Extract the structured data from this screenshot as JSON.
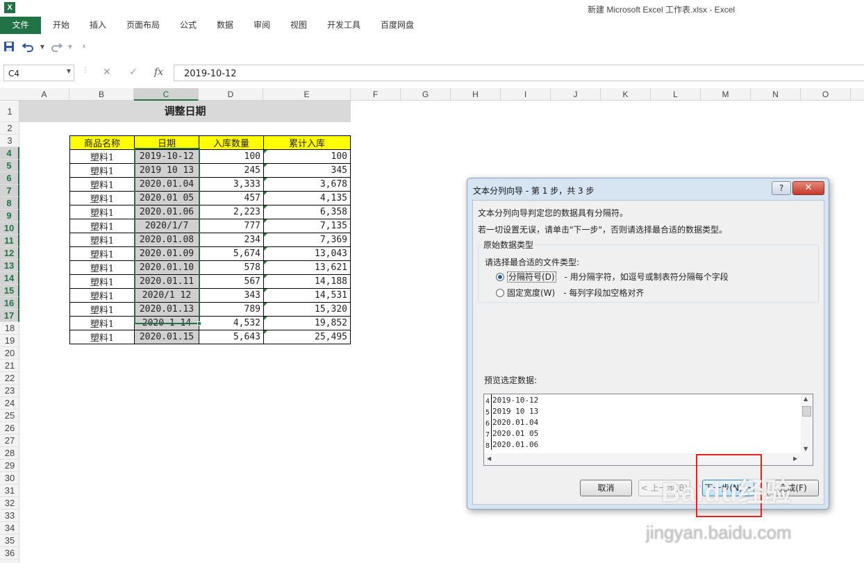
{
  "window": {
    "title": "新建 Microsoft Excel 工作表.xlsx - Excel",
    "app_icon": "X"
  },
  "ribbon": {
    "tabs": [
      "文件",
      "开始",
      "插入",
      "页面布局",
      "公式",
      "数据",
      "审阅",
      "视图",
      "开发工具",
      "百度网盘"
    ]
  },
  "qat": {
    "icons": [
      "save-icon",
      "undo-icon",
      "redo-icon",
      "customize-icon"
    ]
  },
  "formula_bar": {
    "name_box": "C4",
    "cancel": "✕",
    "enter": "✓",
    "fx": "fx",
    "value": "2019-10-12"
  },
  "grid": {
    "columns": [
      "A",
      "B",
      "C",
      "D",
      "E",
      "F",
      "G",
      "H",
      "I",
      "J",
      "K",
      "L",
      "M",
      "N",
      "O"
    ],
    "selected_column": "C",
    "rows": [
      "1",
      "2",
      "3",
      "4",
      "5",
      "6",
      "7",
      "8",
      "9",
      "10",
      "11",
      "12",
      "13",
      "14",
      "15",
      "16",
      "17",
      "18",
      "19",
      "20",
      "21",
      "22",
      "23",
      "24",
      "25",
      "26",
      "27",
      "28",
      "29",
      "30",
      "31",
      "32",
      "33",
      "34",
      "35",
      "36"
    ],
    "selected_rows": [
      "4",
      "5",
      "6",
      "7",
      "8",
      "9",
      "10",
      "11",
      "12",
      "13",
      "14",
      "15",
      "16",
      "17"
    ]
  },
  "sheet": {
    "title": "调整日期",
    "headers": [
      "商品名称",
      "日期",
      "入库数量",
      "累计入库"
    ],
    "rows": [
      [
        "塑料1",
        "2019-10-12",
        "100",
        "100"
      ],
      [
        "塑料1",
        "2019 10 13",
        "245",
        "345"
      ],
      [
        "塑料1",
        "2020.01.04",
        "3,333",
        "3,678"
      ],
      [
        "塑料1",
        "2020.01 05",
        "457",
        "4,135"
      ],
      [
        "塑料1",
        "2020.01.06",
        "2,223",
        "6,358"
      ],
      [
        "塑料1",
        "2020/1/7",
        "777",
        "7,135"
      ],
      [
        "塑料1",
        "2020.01.08",
        "234",
        "7,369"
      ],
      [
        "塑料1",
        "2020.01.09",
        "5,674",
        "13,043"
      ],
      [
        "塑料1",
        "2020.01.10",
        "578",
        "13,621"
      ],
      [
        "塑料1",
        "2020.01.11",
        "567",
        "14,188"
      ],
      [
        "塑料1",
        "2020/1 12",
        "343",
        "14,531"
      ],
      [
        "塑料1",
        "2020.01.13",
        "789",
        "15,320"
      ],
      [
        "塑料1",
        "2020-1 14",
        "4,532",
        "19,852"
      ],
      [
        "塑料1",
        "2020.01.15",
        "5,643",
        "25,495"
      ]
    ]
  },
  "dialog": {
    "title": "文本分列向导 - 第 1 步，共 3 步",
    "help": "?",
    "close": "✕",
    "line1": "文本分列向导判定您的数据具有分隔符。",
    "line2": "若一切设置无误，请单击\"下一步\"，否则请选择最合适的数据类型。",
    "group_label": "原始数据类型",
    "prompt": "请选择最合适的文件类型:",
    "option_delimited": {
      "label": "分隔符号(D)",
      "desc": "- 用分隔字符，如逗号或制表符分隔每个字段",
      "checked": true
    },
    "option_fixed": {
      "label": "固定宽度(W)",
      "desc": "- 每列字段加空格对齐",
      "checked": false
    },
    "preview_label": "预览选定数据:",
    "preview": [
      {
        "n": "4",
        "v": "2019-10-12"
      },
      {
        "n": "5",
        "v": "2019 10 13"
      },
      {
        "n": "6",
        "v": "2020.01.04"
      },
      {
        "n": "7",
        "v": "2020.01 05"
      },
      {
        "n": "8",
        "v": "2020.01.06"
      }
    ],
    "buttons": {
      "cancel": "取消",
      "back": "< 上一步(B)",
      "next": "下一步(N) >",
      "finish": "完成(F)"
    }
  },
  "watermark": {
    "brand": "Baidu经验",
    "url": "jingyan.baidu.com"
  },
  "colors": {
    "excel_green": "#217346",
    "header_yellow": "#ffff00",
    "highlight_red": "#e8201f"
  }
}
